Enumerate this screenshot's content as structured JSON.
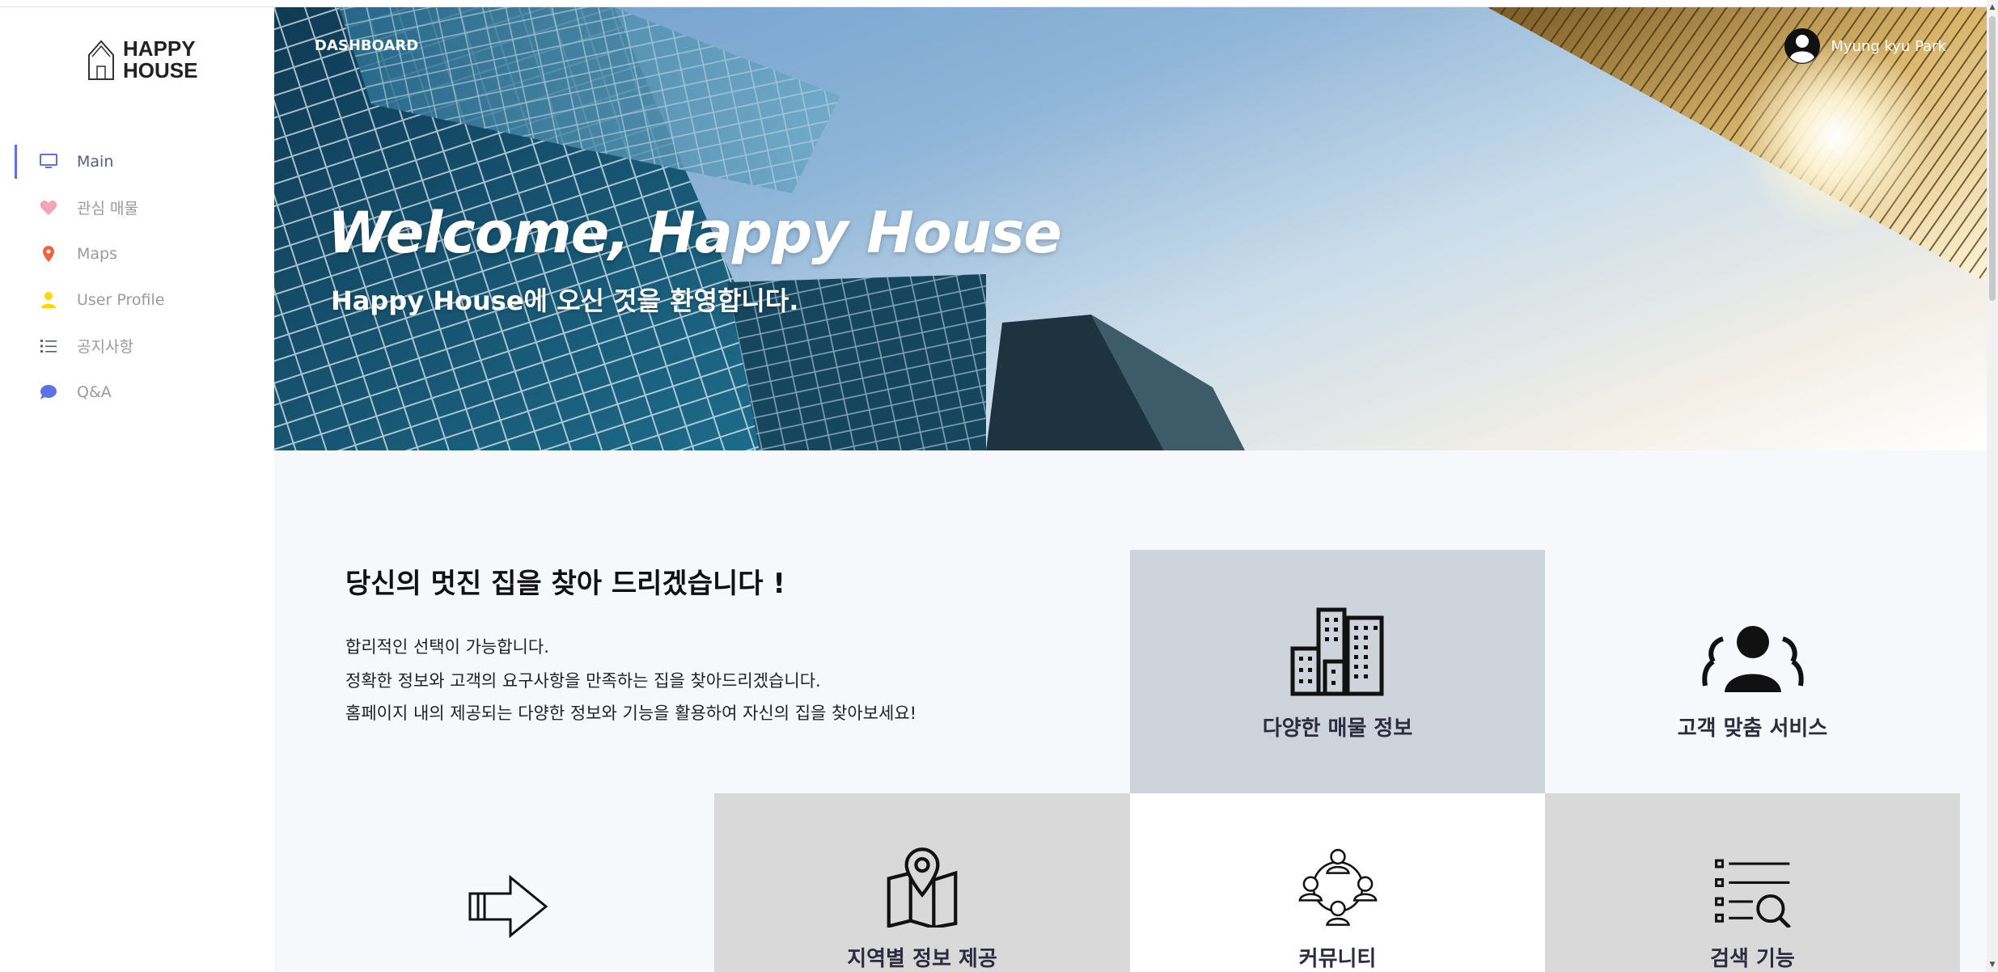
{
  "sidebar": {
    "logo_line1": "HAPPY",
    "logo_line2": "HOUSE",
    "items": [
      {
        "label": "Main",
        "icon": "monitor-icon",
        "color": "#5e72e4"
      },
      {
        "label": "관심 매물",
        "icon": "heart-icon",
        "color": "#f3a4b5"
      },
      {
        "label": "Maps",
        "icon": "pin-icon",
        "color": "#f5603c"
      },
      {
        "label": "User Profile",
        "icon": "user-icon",
        "color": "#ffd600"
      },
      {
        "label": "공지사항",
        "icon": "list-icon",
        "color": "#525f7f"
      },
      {
        "label": "Q&A",
        "icon": "chat-bubble-icon",
        "color": "#5e72e4"
      }
    ]
  },
  "header": {
    "breadcrumb": "DASHBOARD",
    "user_name": "Myung kyu Park"
  },
  "hero": {
    "title": "Welcome, Happy House",
    "subtitle": "Happy House에 오신 것을 환영합니다."
  },
  "intro": {
    "title": "당신의 멋진 집을 찾아 드리겠습니다 !",
    "lines": [
      "합리적인 선택이 가능합니다.",
      "정확한 정보와 고객의 요구사항을 만족하는 집을 찾아드리겠습니다.",
      "홈페이지 내의 제공되는 다양한 정보와 기능을 활용하여 자신의 집을 찾아보세요!"
    ]
  },
  "features": [
    {
      "label": "다양한 매물 정보",
      "icon": "buildings-icon"
    },
    {
      "label": "고객 맞춤 서비스",
      "icon": "customers-icon"
    },
    {
      "label": "",
      "icon": "arrow-right-icon"
    },
    {
      "label": "지역별 정보 제공",
      "icon": "map-pin-icon"
    },
    {
      "label": "커뮤니티",
      "icon": "community-icon"
    },
    {
      "label": "검색 기능",
      "icon": "search-list-icon"
    }
  ],
  "colors": {
    "accent": "#5e72e4",
    "tile_gray_dark": "#cfd3db",
    "tile_gray_light": "#d9d9d9",
    "tile_white": "#ffffff"
  }
}
